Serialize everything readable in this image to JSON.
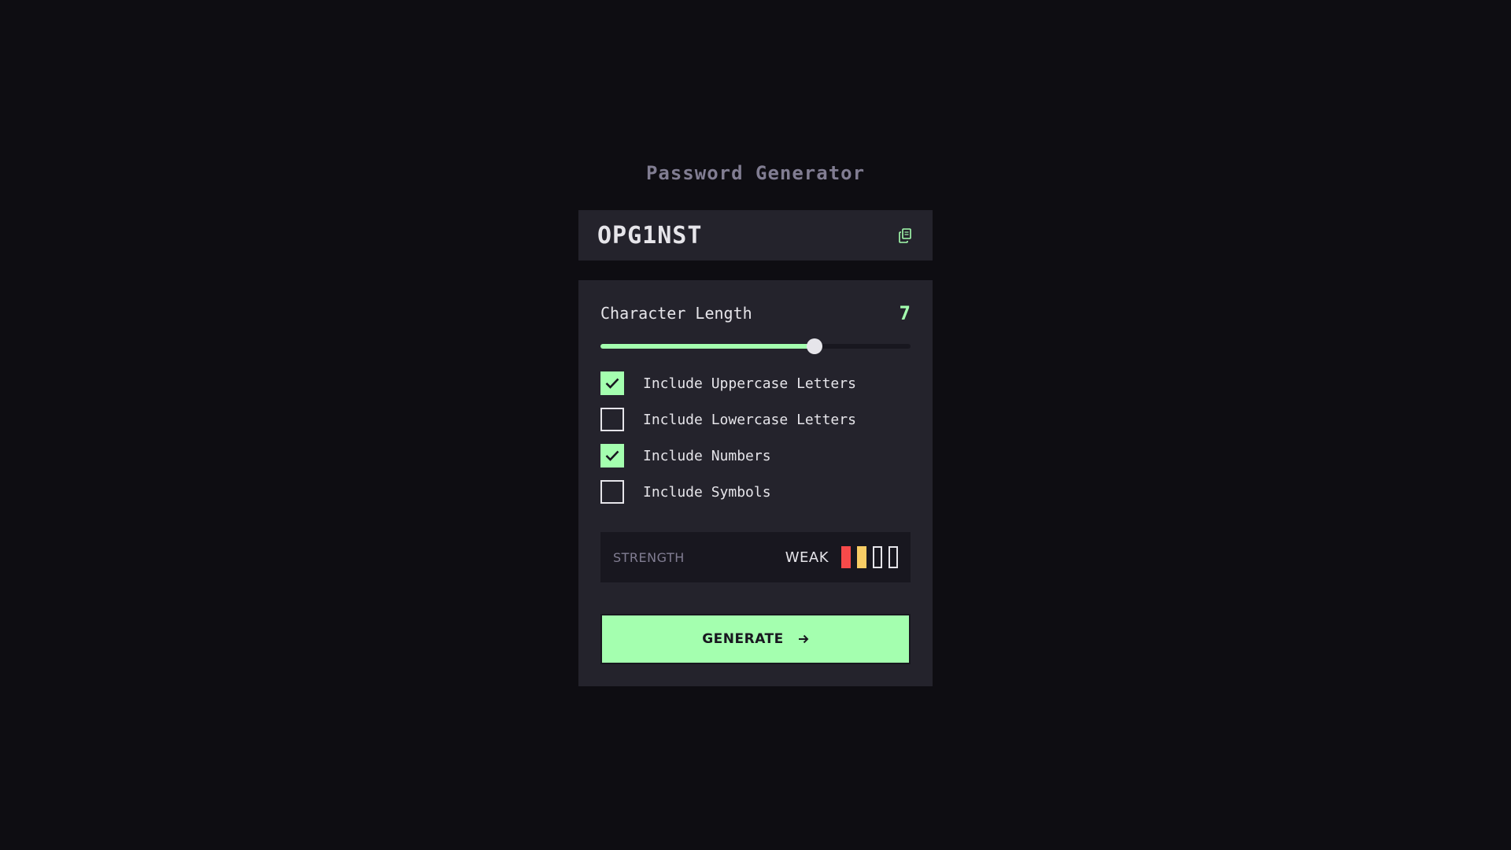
{
  "app": {
    "title": "Password Generator"
  },
  "password": {
    "value": "OPG1NST",
    "copy_icon": "copy-icon"
  },
  "length": {
    "label": "Character Length",
    "value": "7",
    "fraction": 0.69
  },
  "options": [
    {
      "label": "Include Uppercase Letters",
      "checked": true
    },
    {
      "label": "Include Lowercase Letters",
      "checked": false
    },
    {
      "label": "Include Numbers",
      "checked": true
    },
    {
      "label": "Include Symbols",
      "checked": false
    }
  ],
  "strength": {
    "label": "STRENGTH",
    "value": "WEAK",
    "bars_filled": 2,
    "bars_total": 4,
    "bar_colors": [
      "#f64a4a",
      "#f8cd65"
    ]
  },
  "generate": {
    "label": "GENERATE",
    "icon": "arrow-right-icon"
  },
  "colors": {
    "background": "#0e0d12",
    "panel": "#24232c",
    "accent": "#a4ffaf",
    "text": "#e6e5ea",
    "muted": "#817d92"
  }
}
